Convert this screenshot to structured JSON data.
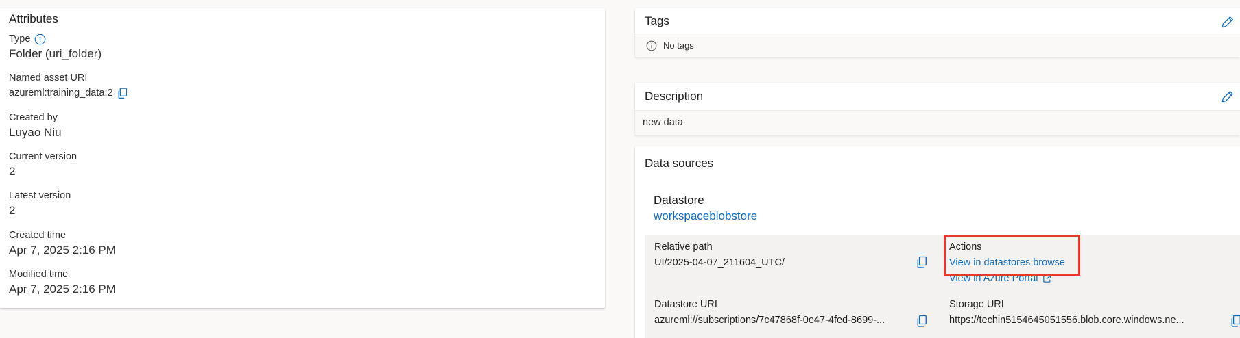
{
  "attributes": {
    "title": "Attributes",
    "items": [
      {
        "label": "Type",
        "value": "Folder (uri_folder)"
      },
      {
        "label": "Named asset URI",
        "value": "azureml:training_data:2"
      },
      {
        "label": "Created by",
        "value": "Luyao Niu"
      },
      {
        "label": "Current version",
        "value": "2"
      },
      {
        "label": "Latest version",
        "value": "2"
      },
      {
        "label": "Created time",
        "value": "Apr 7, 2025 2:16 PM"
      },
      {
        "label": "Modified time",
        "value": "Apr 7, 2025 2:16 PM"
      }
    ]
  },
  "tags": {
    "title": "Tags",
    "empty_text": "No tags"
  },
  "description": {
    "title": "Description",
    "text": "new data"
  },
  "data_sources": {
    "title": "Data sources",
    "datastore_label": "Datastore",
    "datastore_link": "workspaceblobstore",
    "relative_path_label": "Relative path",
    "relative_path_value": "UI/2025-04-07_211604_UTC/",
    "actions_label": "Actions",
    "action_browse": "View in datastores browse",
    "action_portal": "View in Azure Portal",
    "datastore_uri_label": "Datastore URI",
    "datastore_uri_value": "azureml://subscriptions/7c47868f-0e47-4fed-8699-...",
    "storage_uri_label": "Storage URI",
    "storage_uri_value": "https://techin5154645051556.blob.core.windows.ne..."
  },
  "colors": {
    "link": "#0f6cbd",
    "highlight": "#e53a2b"
  },
  "icons": [
    "info-icon",
    "copy-icon",
    "edit-icon",
    "external-link-icon"
  ]
}
